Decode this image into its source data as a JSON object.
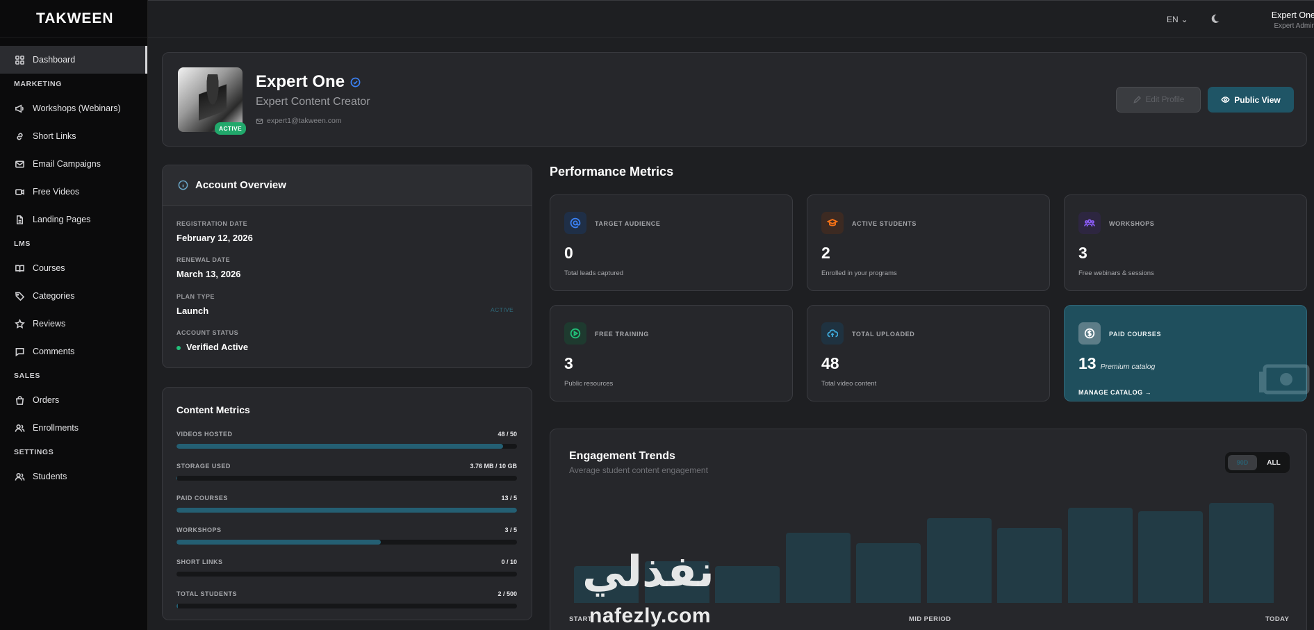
{
  "brand": "TAKWEEN",
  "sidebar": {
    "dashboard": "Dashboard",
    "sections": {
      "marketing": "MARKETING",
      "lms": "LMS",
      "sales": "SALES",
      "settings": "SETTINGS"
    },
    "items": {
      "workshops": "Workshops (Webinars)",
      "short_links": "Short Links",
      "email_campaigns": "Email Campaigns",
      "free_videos": "Free Videos",
      "landing_pages": "Landing Pages",
      "courses": "Courses",
      "categories": "Categories",
      "reviews": "Reviews",
      "comments": "Comments",
      "orders": "Orders",
      "enrollments": "Enrollments",
      "students": "Students"
    }
  },
  "topbar": {
    "lang": "EN",
    "user_name": "Expert One",
    "user_role": "Expert Admin"
  },
  "profile": {
    "name": "Expert One",
    "subtitle": "Expert Content Creator",
    "email": "expert1@takween.com",
    "status": "ACTIVE",
    "edit_label": "Edit Profile",
    "public_label": "Public View"
  },
  "account": {
    "title": "Account Overview",
    "registration_label": "REGISTRATION DATE",
    "registration_value": "February 12, 2026",
    "renewal_label": "RENEWAL DATE",
    "renewal_value": "March 13, 2026",
    "plan_label": "PLAN TYPE",
    "plan_value": "Launch",
    "plan_tag": "ACTIVE",
    "status_label": "ACCOUNT STATUS",
    "status_value": "Verified Active"
  },
  "content_metrics": {
    "title": "Content Metrics",
    "rows": [
      {
        "label": "VIDEOS HOSTED",
        "value": "48 / 50",
        "fraction": 0.96
      },
      {
        "label": "STORAGE USED",
        "value": "3.76 MB / 10 GB",
        "fraction": 0.0004
      },
      {
        "label": "PAID COURSES",
        "value": "13 / 5",
        "fraction": 1.0
      },
      {
        "label": "WORKSHOPS",
        "value": "3 / 5",
        "fraction": 0.6
      },
      {
        "label": "SHORT LINKS",
        "value": "0 / 10",
        "fraction": 0
      },
      {
        "label": "TOTAL STUDENTS",
        "value": "2 / 500",
        "fraction": 0.004
      }
    ]
  },
  "performance": {
    "title": "Performance Metrics",
    "cards": [
      {
        "label": "TARGET AUDIENCE",
        "value": "0",
        "desc": "Total leads captured",
        "icon": "at-icon",
        "color": "#3b82f6",
        "bg": "#1f2f47"
      },
      {
        "label": "ACTIVE STUDENTS",
        "value": "2",
        "desc": "Enrolled in your programs",
        "icon": "graduation-cap-icon",
        "color": "#f97316",
        "bg": "#3c2a22"
      },
      {
        "label": "WORKSHOPS",
        "value": "3",
        "desc": "Free webinars & sessions",
        "icon": "users-icon",
        "color": "#8b5cf6",
        "bg": "#2d2640"
      },
      {
        "label": "FREE TRAINING",
        "value": "3",
        "desc": "Public resources",
        "icon": "play-circle-icon",
        "color": "#22c17a",
        "bg": "#1e3a2f"
      },
      {
        "label": "TOTAL UPLOADED",
        "value": "48",
        "desc": "Total video content",
        "icon": "cloud-upload-icon",
        "color": "#3ea8d8",
        "bg": "#1f3240"
      },
      {
        "label": "PAID COURSES",
        "value": "13",
        "desc": "Premium catalog",
        "manage": "MANAGE CATALOG →",
        "icon": "dollar-circle-icon"
      }
    ]
  },
  "engagement": {
    "title": "Engagement Trends",
    "subtitle": "Average student content engagement",
    "toggle_active": "90D",
    "toggle_all": "ALL",
    "x_start": "START",
    "x_mid": "MID PERIOD",
    "x_end": "TODAY"
  },
  "chart_data": {
    "type": "bar",
    "title": "Engagement Trends",
    "values": [
      0.22,
      0.25,
      0.22,
      0.42,
      0.36,
      0.51,
      0.45,
      0.57,
      0.55,
      0.6
    ],
    "ylim": [
      0,
      1
    ],
    "x_labels": [
      "START",
      "MID PERIOD",
      "TODAY"
    ],
    "grid": false
  },
  "watermark": {
    "arabic": "نفذلي",
    "latin": "nafezly.com"
  }
}
